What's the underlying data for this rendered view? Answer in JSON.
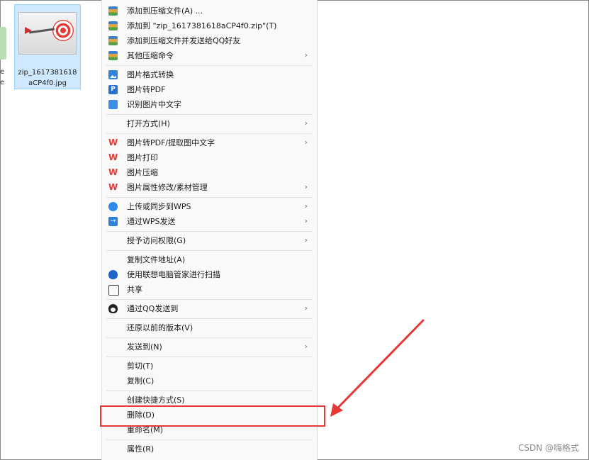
{
  "file": {
    "name": "zip_1617381618aCP4f0.jpg"
  },
  "left_edge": {
    "text": "e\ne"
  },
  "menu": {
    "groups": [
      [
        {
          "icon": "archive-icon",
          "label": "添加到压缩文件(A) ...",
          "submenu": false
        },
        {
          "icon": "archive-icon",
          "label": "添加到 \"zip_1617381618aCP4f0.zip\"(T)",
          "submenu": false
        },
        {
          "icon": "archive-icon",
          "label": "添加到压缩文件并发送给QQ好友",
          "submenu": false
        },
        {
          "icon": "archive-icon",
          "label": "其他压缩命令",
          "submenu": true
        }
      ],
      [
        {
          "icon": "image-convert-icon",
          "label": "图片格式转换",
          "submenu": false
        },
        {
          "icon": "pdf-icon",
          "label": "图片转PDF",
          "submenu": false
        },
        {
          "icon": "ocr-icon",
          "label": "识别图片中文字",
          "submenu": false
        }
      ],
      [
        {
          "icon": "",
          "label": "打开方式(H)",
          "submenu": true
        }
      ],
      [
        {
          "icon": "wps-icon",
          "label": "图片转PDF/提取图中文字",
          "submenu": true
        },
        {
          "icon": "wps-icon",
          "label": "图片打印",
          "submenu": false
        },
        {
          "icon": "wps-icon",
          "label": "图片压缩",
          "submenu": false
        },
        {
          "icon": "wps-icon",
          "label": "图片属性修改/素材管理",
          "submenu": true
        }
      ],
      [
        {
          "icon": "cloud-upload-icon",
          "label": "上传或同步到WPS",
          "submenu": true
        },
        {
          "icon": "send-icon",
          "label": "通过WPS发送",
          "submenu": true
        }
      ],
      [
        {
          "icon": "",
          "label": "授予访问权限(G)",
          "submenu": true
        }
      ],
      [
        {
          "icon": "",
          "label": "复制文件地址(A)",
          "submenu": false
        },
        {
          "icon": "shield-icon",
          "label": "使用联想电脑管家进行扫描",
          "submenu": false
        },
        {
          "icon": "share-icon",
          "label": "共享",
          "submenu": false
        }
      ],
      [
        {
          "icon": "qq-icon",
          "label": "通过QQ发送到",
          "submenu": true
        }
      ],
      [
        {
          "icon": "",
          "label": "还原以前的版本(V)",
          "submenu": false
        }
      ],
      [
        {
          "icon": "",
          "label": "发送到(N)",
          "submenu": true
        }
      ],
      [
        {
          "icon": "",
          "label": "剪切(T)",
          "submenu": false
        },
        {
          "icon": "",
          "label": "复制(C)",
          "submenu": false
        }
      ],
      [
        {
          "icon": "",
          "label": "创建快捷方式(S)",
          "submenu": false
        },
        {
          "icon": "",
          "label": "删除(D)",
          "submenu": false
        },
        {
          "icon": "",
          "label": "重命名(M)",
          "submenu": false
        }
      ],
      [
        {
          "icon": "",
          "label": "属性(R)",
          "submenu": false
        }
      ]
    ],
    "submenu_arrow": "›",
    "highlighted_item": "删除(D)"
  },
  "annotation": {
    "color": "#e53935"
  },
  "watermark": "CSDN @嗨格式"
}
